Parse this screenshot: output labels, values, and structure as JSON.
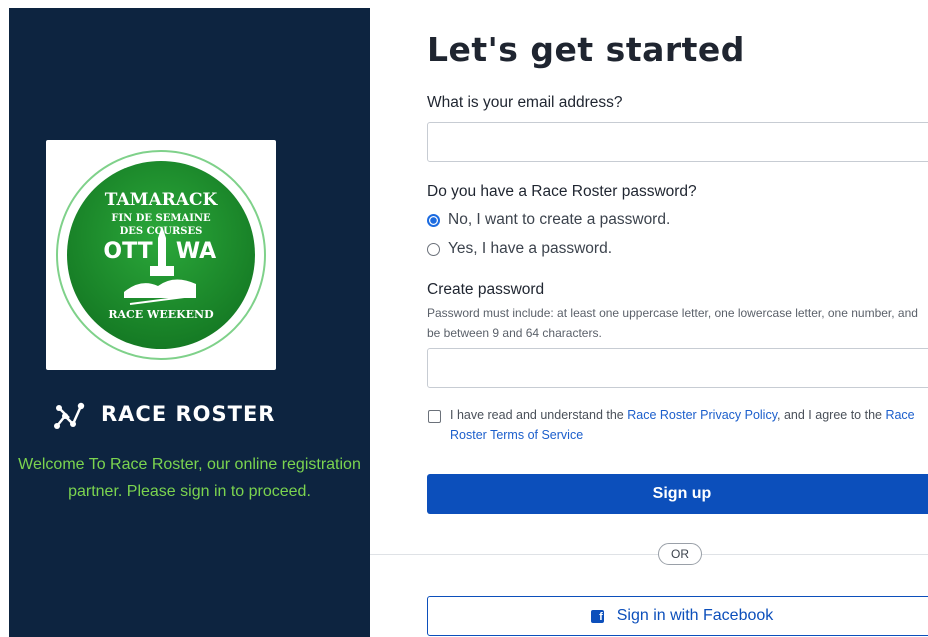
{
  "left_panel": {
    "logo": {
      "line1": "TAMARACK",
      "line2": "FIN DE SEMAINE",
      "line3": "DES COURSES",
      "city_left": "OTT",
      "city_right": "WA",
      "bottom": "RACE WEEKEND"
    },
    "brand": "RACE ROSTER",
    "welcome": "Welcome To Race Roster, our online registration partner. Please sign in to proceed."
  },
  "form": {
    "heading": "Let's get started",
    "email_label": "What is your email address?",
    "email_value": "",
    "password_question": "Do you have a Race Roster password?",
    "option_no": "No, I want to create a password.",
    "option_yes": "Yes, I have a password.",
    "create_label": "Create password",
    "password_help": "Password must include: at least one uppercase letter, one lowercase letter, one number, and be between 9 and 64 characters.",
    "password_value": "",
    "agree_prefix": "I have read and understand the ",
    "privacy_link": "Race Roster Privacy Policy",
    "agree_middle": ", and I agree to the ",
    "terms_link": "Race Roster Terms of Service",
    "signup_label": "Sign up",
    "or_label": "OR",
    "facebook_label": "Sign in with Facebook"
  },
  "colors": {
    "panel": "#0d2440",
    "welcome_text": "#7bd44f",
    "primary": "#0c4fbb",
    "logo_green": "#1f8f2c"
  }
}
